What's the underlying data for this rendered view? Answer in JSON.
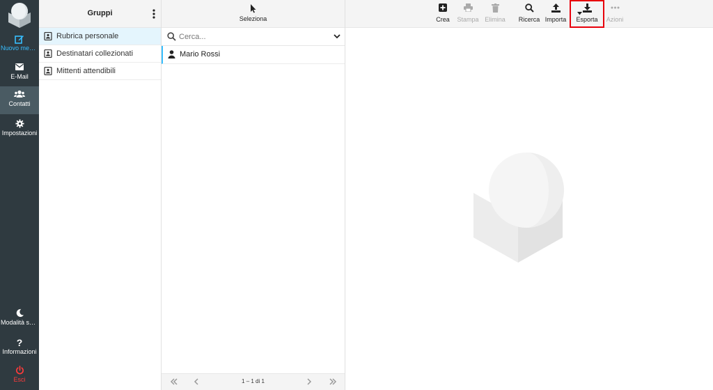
{
  "nav": {
    "compose": "Nuovo messaggio",
    "mail": "E-Mail",
    "contacts": "Contatti",
    "settings": "Impostazioni",
    "darkmode": "Modalità scura",
    "about": "Informazioni",
    "logout": "Esci"
  },
  "groups": {
    "title": "Gruppi",
    "items": [
      "Rubrica personale",
      "Destinatari collezionati",
      "Mittenti attendibili"
    ]
  },
  "contacts": {
    "select_label": "Seleziona",
    "search_placeholder": "Cerca...",
    "list": [
      "Mario Rossi"
    ],
    "pager_count": "1 – 1 di 1"
  },
  "toolbar": {
    "create": "Crea",
    "print": "Stampa",
    "delete": "Elimina",
    "search": "Ricerca",
    "import": "Importa",
    "export": "Esporta",
    "actions": "Azioni"
  },
  "colors": {
    "nav_bg": "#2f3a40",
    "accent": "#37beff",
    "logout": "#ff3b3b",
    "highlight_border": "#e8000b"
  }
}
